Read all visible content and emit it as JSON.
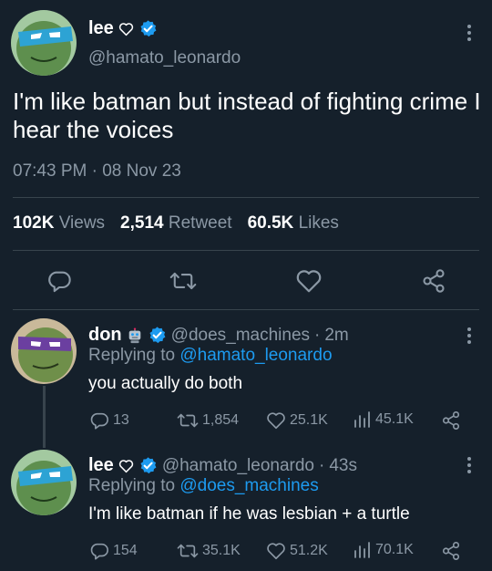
{
  "main_tweet": {
    "display_name": "lee",
    "handle": "@hamato_leonardo",
    "text": "I'm like batman but instead of fighting crime I hear the voices",
    "time": "07:43 PM",
    "date": "08 Nov 23",
    "meta_separator": "·",
    "stats": {
      "views_count": "102K",
      "views_label": "Views",
      "retweets_count": "2,514",
      "retweets_label": "Retweet",
      "likes_count": "60.5K",
      "likes_label": "Likes"
    }
  },
  "replies": [
    {
      "display_name": "don",
      "handle": "@does_machines",
      "separator": "·",
      "time": "2m",
      "replying_label": "Replying to",
      "replying_to": "@hamato_leonardo",
      "text": "you actually do both",
      "replies": "13",
      "retweets": "1,854",
      "likes": "25.1K",
      "views": "45.1K"
    },
    {
      "display_name": "lee",
      "handle": "@hamato_leonardo",
      "separator": "·",
      "time": "43s",
      "replying_label": "Replying to",
      "replying_to": "@does_machines",
      "text": "I'm like batman if he was lesbian + a turtle",
      "replies": "154",
      "retweets": "35.1K",
      "likes": "51.2K",
      "views": "70.1K"
    }
  ],
  "colors": {
    "background": "#15202b",
    "text": "#ffffff",
    "muted": "#8b98a5",
    "link": "#1d9bf0",
    "verified": "#1d9bf0",
    "divider": "#38444d"
  },
  "icons": [
    "heart-outline-icon",
    "verified-badge-icon",
    "robot-emoji-icon",
    "more-vertical-icon",
    "reply-icon",
    "retweet-icon",
    "like-icon",
    "views-icon",
    "share-icon"
  ]
}
